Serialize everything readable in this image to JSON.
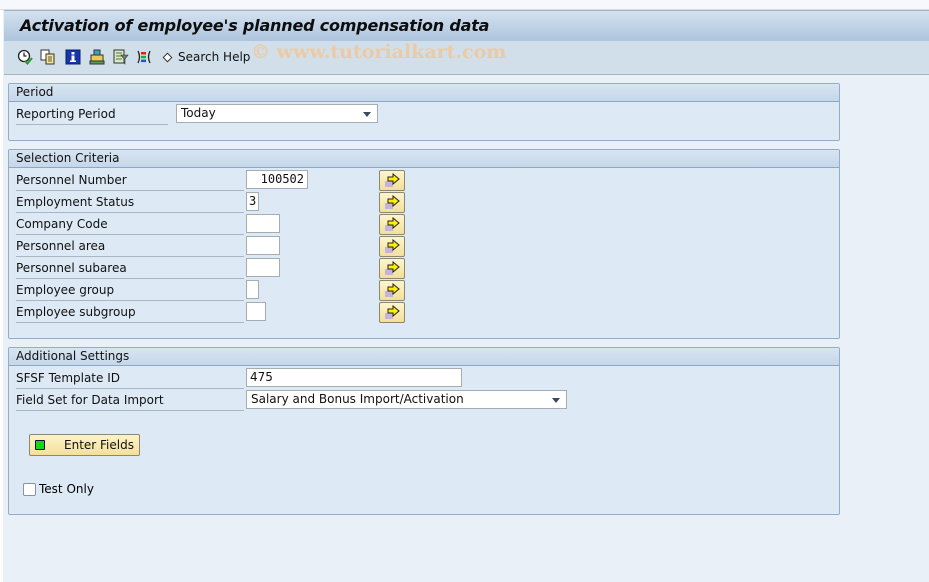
{
  "window": {
    "title": "Activation of employee's planned compensation data",
    "watermark": "© www.tutorialkart.com"
  },
  "toolbar": {
    "icons": [
      {
        "name": "execute-icon",
        "tooltip": "Execute"
      },
      {
        "name": "get-variant-icon",
        "tooltip": "Get Variant"
      },
      {
        "name": "program-documentation-icon",
        "tooltip": "Program Documentation"
      },
      {
        "name": "print-icon",
        "tooltip": "Print"
      },
      {
        "name": "dynamic-selections-icon",
        "tooltip": "Dynamic Selections"
      },
      {
        "name": "selection-options-icon",
        "tooltip": "Selection Options"
      }
    ],
    "search_help_label": "Search Help"
  },
  "period": {
    "title": "Period",
    "reporting_period_label": "Reporting Period",
    "reporting_period_value": "Today"
  },
  "selection": {
    "title": "Selection Criteria",
    "fields": [
      {
        "label": "Personnel Number",
        "value": "100502"
      },
      {
        "label": "Employment Status",
        "value": "3"
      },
      {
        "label": "Company Code",
        "value": ""
      },
      {
        "label": "Personnel area",
        "value": ""
      },
      {
        "label": "Personnel subarea",
        "value": ""
      },
      {
        "label": "Employee group",
        "value": ""
      },
      {
        "label": "Employee subgroup",
        "value": ""
      }
    ]
  },
  "additional": {
    "title": "Additional Settings",
    "template_label": "SFSF Template ID",
    "template_value": "475",
    "fieldset_label": "Field Set for Data Import",
    "fieldset_value": "Salary and Bonus Import/Activation",
    "enter_fields_label": "Enter Fields",
    "test_only_label": "Test Only",
    "test_only_checked": false
  },
  "colors": {
    "background": "#e9f0f7",
    "group_fill": "#dde9f4",
    "button_yellow": "#f4e09a",
    "led_green": "#19d31c"
  }
}
